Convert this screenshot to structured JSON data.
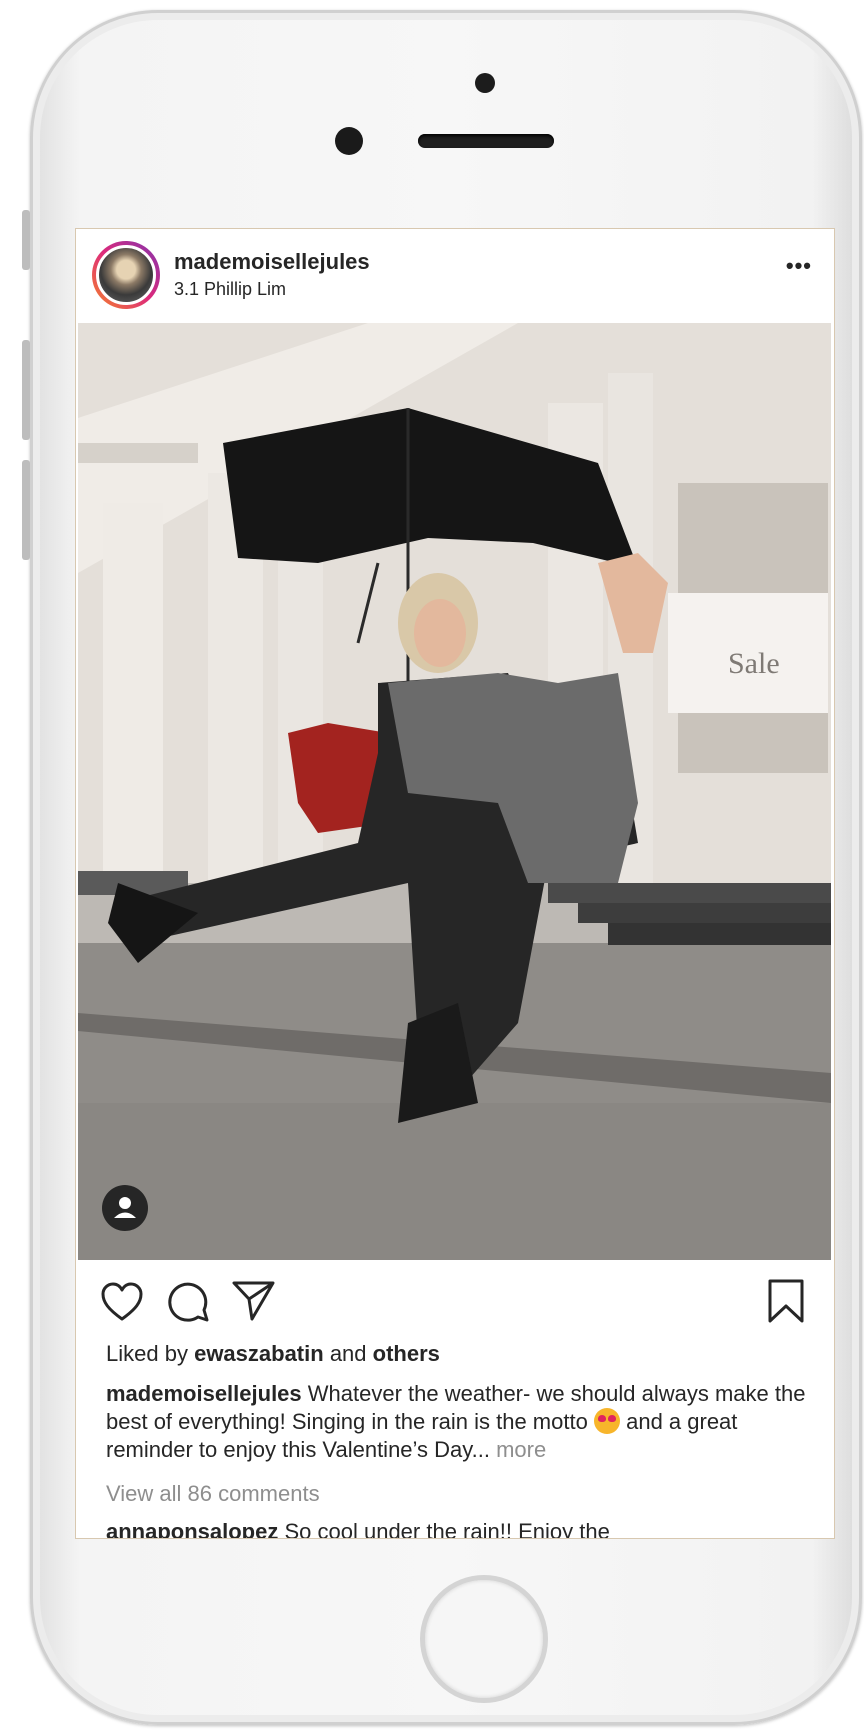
{
  "post": {
    "username": "mademoisellejules",
    "location": "3.1 Phillip Lim",
    "more_label": "•••"
  },
  "likes": {
    "prefix": "Liked by",
    "user": "ewaszabatin",
    "connector": "and",
    "others": "others"
  },
  "caption": {
    "username": "mademoisellejules",
    "text": "Whatever the weather- we should always make the best of everything! Singing in the rain is the motto",
    "text_after_emoji": "and a great reminder to enjoy this Valentine’s Day...",
    "more": "more",
    "emoji": "heart-eyes-emoji"
  },
  "comments": {
    "view_all": "View all 86 comments",
    "next_user": "annaponsalopez",
    "next_text": "So cool under the rain!! Enjoy the"
  },
  "photo": {
    "sign_text": "Sale"
  },
  "icons": [
    "heart-icon",
    "comment-icon",
    "share-icon",
    "bookmark-icon",
    "user-tag-icon",
    "more-options-icon"
  ]
}
